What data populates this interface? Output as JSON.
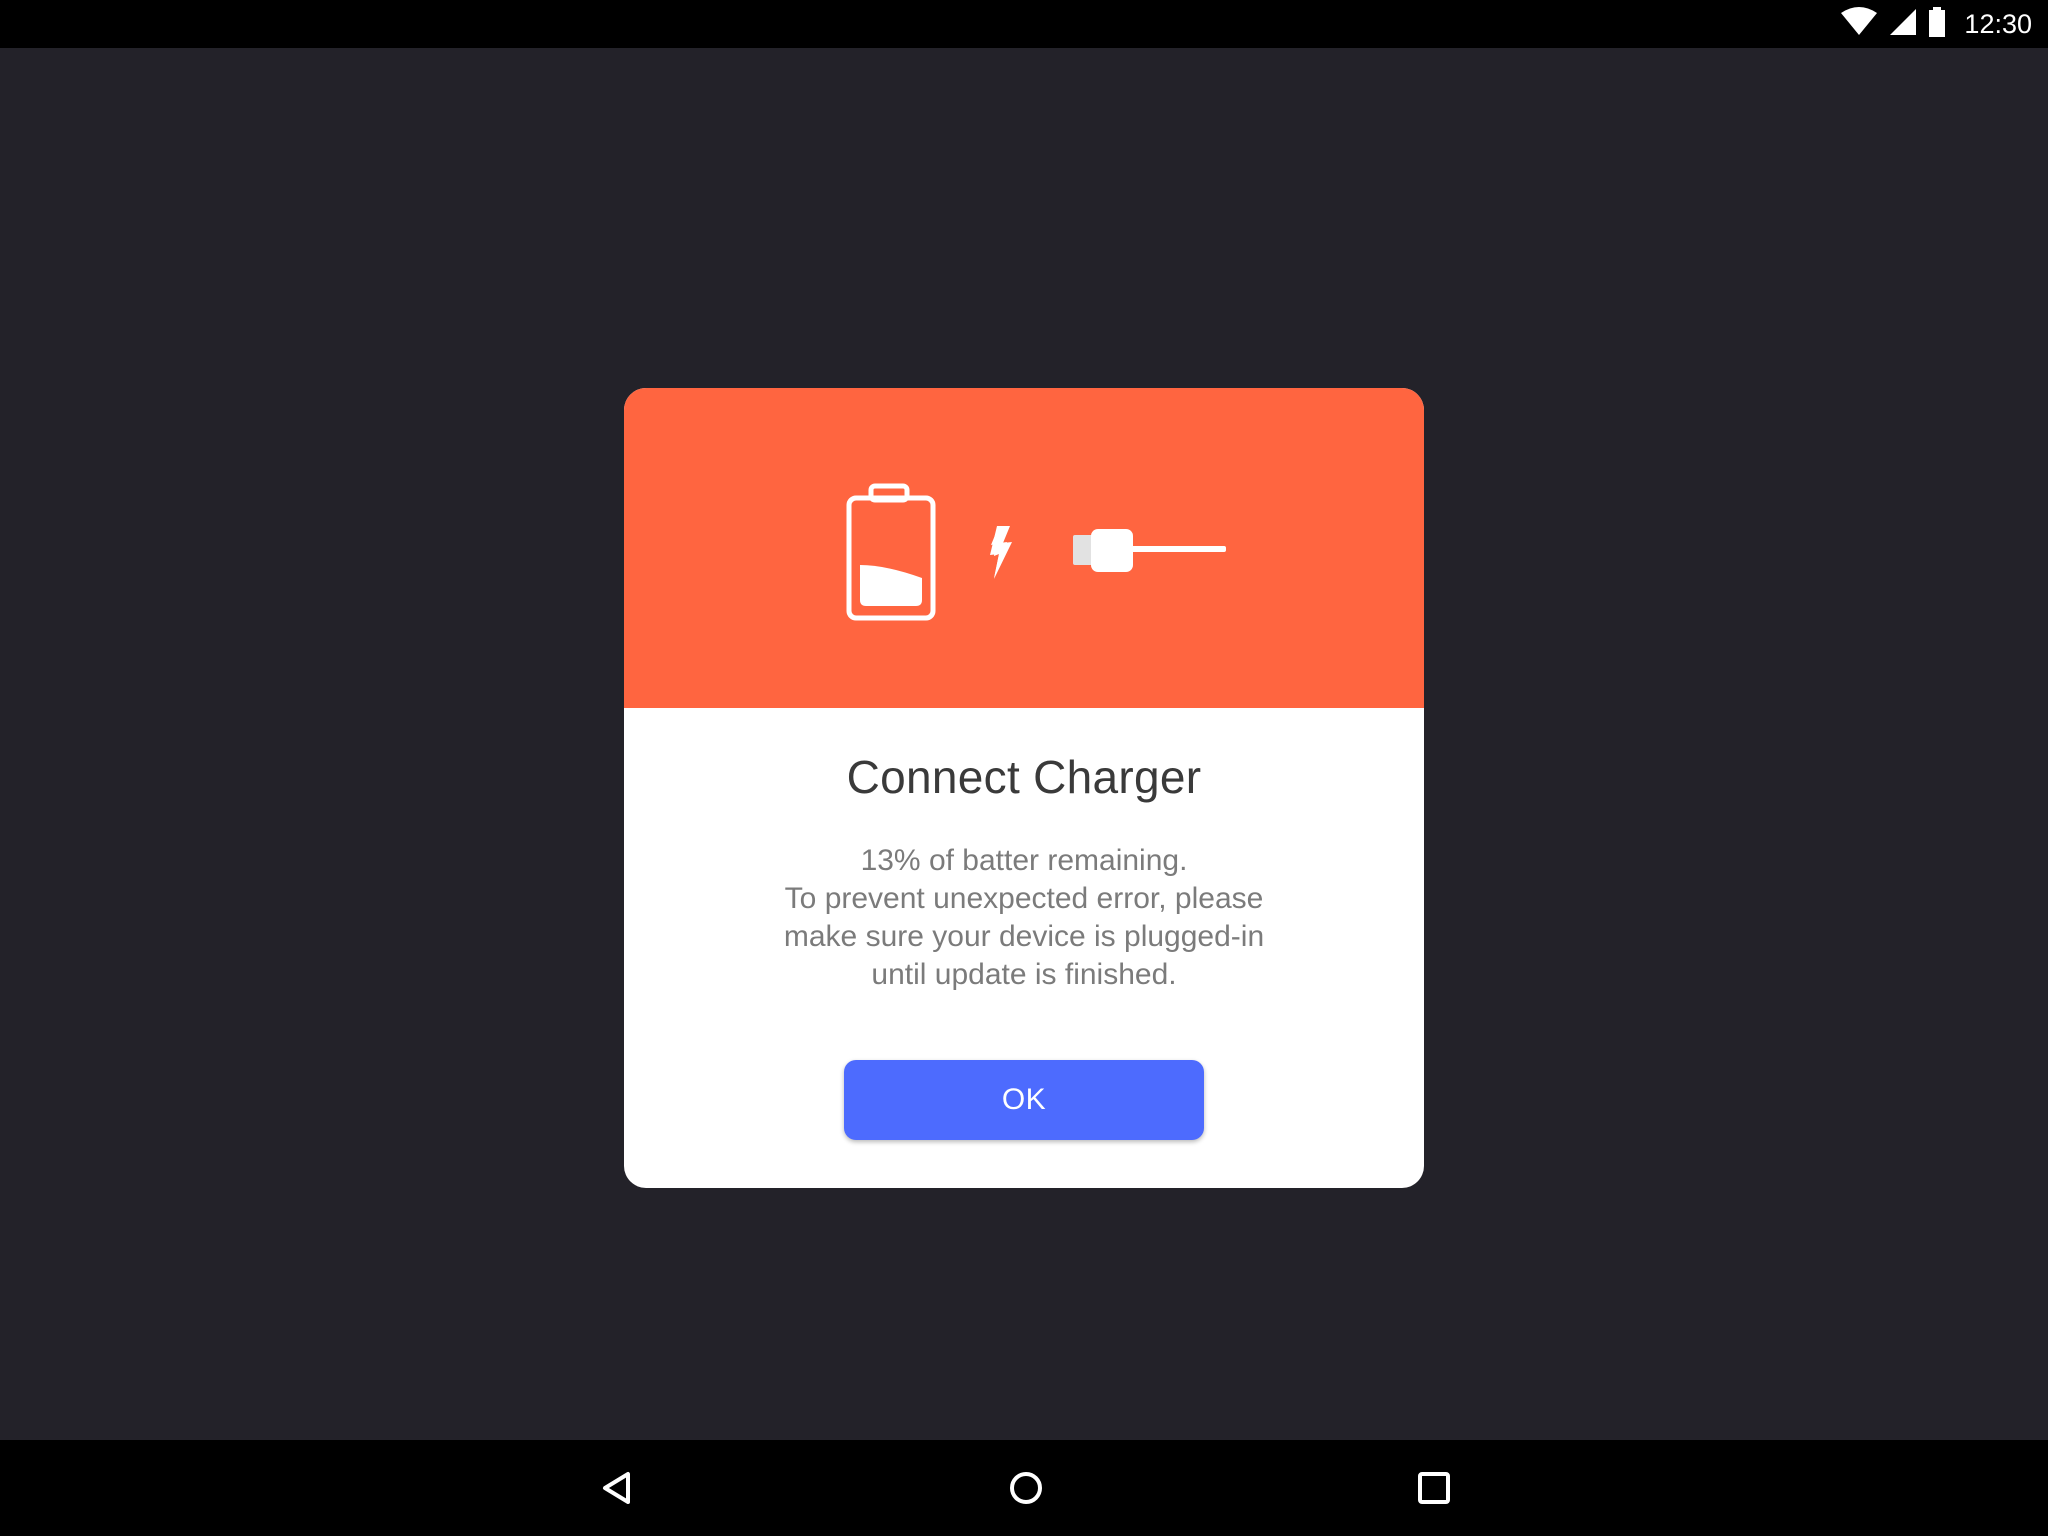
{
  "status_bar": {
    "time": "12:30",
    "icons": [
      "wifi-icon",
      "cellular-signal-icon",
      "battery-icon"
    ]
  },
  "dialog": {
    "header_icons": [
      "low-battery-icon",
      "lightning-bolt-icon",
      "charger-plug-icon"
    ],
    "header_color": "#FF6540",
    "battery_level": 0.13,
    "title": "Connect Charger",
    "message_lines": [
      "13% of batter remaining.",
      "To prevent unexpected error, please",
      "make sure your device is plugged-in",
      "until update is finished."
    ],
    "ok_label": "OK",
    "button_color": "#4D6BFE"
  },
  "nav_bar": {
    "buttons": [
      "back-icon",
      "home-icon",
      "recents-icon"
    ]
  }
}
